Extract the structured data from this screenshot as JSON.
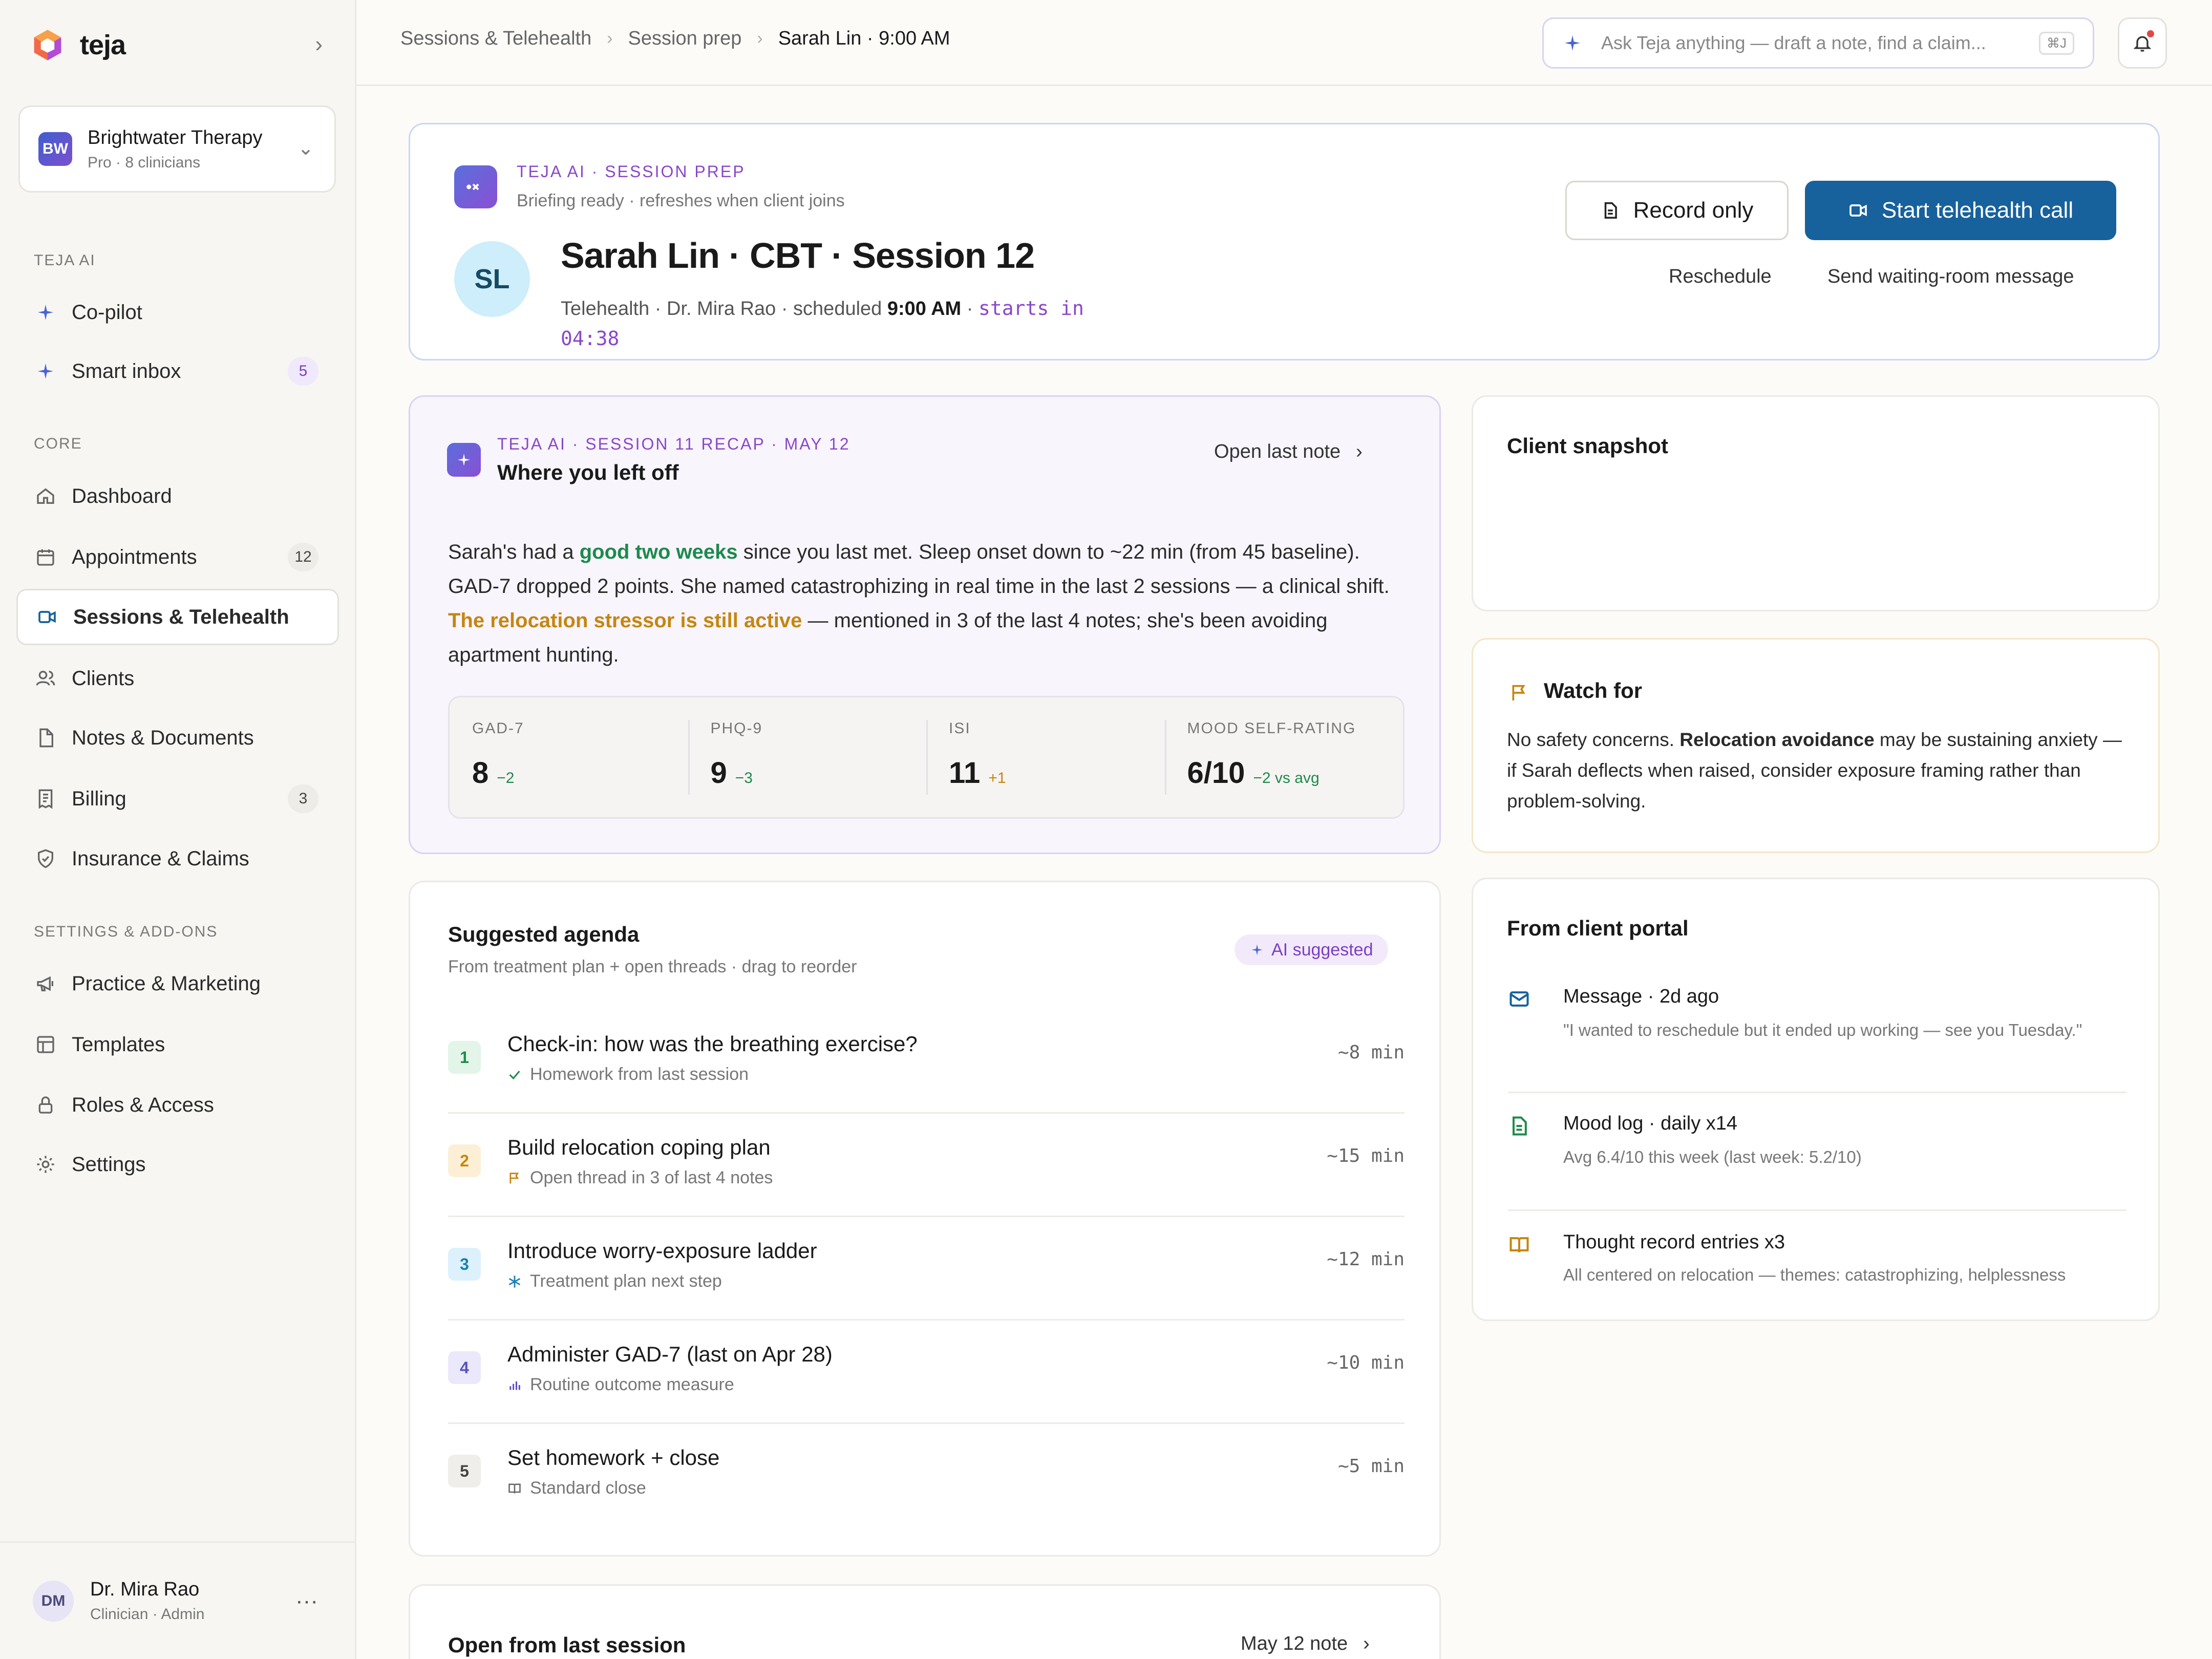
{
  "app": {
    "name": "teja"
  },
  "org": {
    "badge": "BW",
    "name": "Brightwater Therapy",
    "plan": "Pro · 8 clinicians"
  },
  "sidebar": {
    "sections": {
      "ai": "TEJA AI",
      "core": "CORE",
      "settings": "SETTINGS & ADD-ONS"
    },
    "ai_items": [
      {
        "label": "Co-pilot",
        "icon": "sparkle-icon"
      },
      {
        "label": "Smart inbox",
        "icon": "sparkle-icon",
        "count": "5"
      }
    ],
    "core_items": [
      {
        "label": "Dashboard",
        "icon": "home-icon"
      },
      {
        "label": "Appointments",
        "icon": "calendar-icon",
        "count": "12"
      },
      {
        "label": "Sessions & Telehealth",
        "icon": "video-icon",
        "active": true
      },
      {
        "label": "Clients",
        "icon": "users-icon"
      },
      {
        "label": "Notes & Documents",
        "icon": "document-icon"
      },
      {
        "label": "Billing",
        "icon": "receipt-icon",
        "count": "3"
      },
      {
        "label": "Insurance & Claims",
        "icon": "shield-icon"
      }
    ],
    "settings_items": [
      {
        "label": "Practice & Marketing",
        "icon": "megaphone-icon"
      },
      {
        "label": "Templates",
        "icon": "template-icon"
      },
      {
        "label": "Roles & Access",
        "icon": "lock-icon"
      },
      {
        "label": "Settings",
        "icon": "gear-icon"
      }
    ]
  },
  "user": {
    "initials": "DM",
    "name": "Dr. Mira Rao",
    "role": "Clinician · Admin"
  },
  "breadcrumbs": [
    "Sessions & Telehealth",
    "Session prep",
    "Sarah Lin · 9:00 AM"
  ],
  "search": {
    "placeholder": "Ask Teja anything — draft a note, find a claim...",
    "shortcut": "⌘J"
  },
  "prep": {
    "eyebrow": "TEJA AI · SESSION PREP",
    "status": "Briefing ready · refreshes when client joins",
    "initials": "SL",
    "title": "Sarah Lin · CBT · Session 12",
    "meta_prefix": "Telehealth · Dr. Mira Rao · scheduled",
    "time": "9:00 AM",
    "countdown_label": "starts in",
    "countdown": "04:38",
    "record_label": "Record only",
    "start_label": "Start telehealth call",
    "reschedule_label": "Reschedule",
    "waiting_label": "Send waiting-room message"
  },
  "recap": {
    "eyebrow": "TEJA AI · SESSION 11 RECAP · MAY 12",
    "title": "Where you left off",
    "open_label": "Open last note",
    "body": {
      "p1": "Sarah's had a ",
      "h1": "good two weeks",
      "p2": " since you last met. Sleep onset down to ~22 min (from 45 baseline). GAD-7 dropped 2 points. She named catastrophizing in real time in the last 2 sessions — a clinical shift. ",
      "h2": "The relocation stressor is still active",
      "p3": " — mentioned in 3 of the last 4 notes; she's been avoiding apartment hunting."
    },
    "scores": [
      {
        "label": "GAD-7",
        "value": "8",
        "delta": "−2",
        "tone": "green"
      },
      {
        "label": "PHQ-9",
        "value": "9",
        "delta": "−3",
        "tone": "green"
      },
      {
        "label": "ISI",
        "value": "11",
        "delta": "+1",
        "tone": "amber"
      },
      {
        "label": "MOOD SELF-RATING",
        "value": "6/10",
        "delta": "−2 vs avg",
        "tone": "green"
      }
    ]
  },
  "snapshot": {
    "title": "Client snapshot"
  },
  "watch": {
    "title": "Watch for",
    "p1": "No safety concerns. ",
    "bold": "Relocation avoidance",
    "p2": " may be sustaining anxiety — if Sarah deflects when raised, consider exposure framing rather than problem-solving."
  },
  "portal": {
    "title": "From client portal",
    "items": [
      {
        "icon": "mail-icon",
        "title": "Message · 2d ago",
        "sub": "\"I wanted to reschedule but it ended up working — see you Tuesday.\""
      },
      {
        "icon": "journal-icon",
        "title": "Mood log · daily x14",
        "sub": "Avg 6.4/10 this week (last week: 5.2/10)"
      },
      {
        "icon": "book-icon",
        "title": "Thought record entries x3",
        "sub": "All centered on relocation — themes: catastrophizing, helplessness"
      }
    ]
  },
  "agenda": {
    "title": "Suggested agenda",
    "subtitle": "From treatment plan + open threads · drag to reorder",
    "pill": "AI suggested",
    "items": [
      {
        "num": "1",
        "title": "Check-in: how was the breathing exercise?",
        "sub": "Homework from last session",
        "icon": "check-icon",
        "time": "~8 min",
        "bg": "#e2f5e8",
        "fg": "#1d8a4c"
      },
      {
        "num": "2",
        "title": "Build relocation coping plan",
        "sub": "Open thread in 3 of last 4 notes",
        "icon": "flag-icon",
        "time": "~15 min",
        "bg": "#fcefd6",
        "fg": "#c58610"
      },
      {
        "num": "3",
        "title": "Introduce worry-exposure ladder",
        "sub": "Treatment plan next step",
        "icon": "snowflake-icon",
        "time": "~12 min",
        "bg": "#dcf1fb",
        "fg": "#1a7fb0"
      },
      {
        "num": "4",
        "title": "Administer GAD-7 (last on Apr 28)",
        "sub": "Routine outcome measure",
        "icon": "bar-chart-icon",
        "time": "~10 min",
        "bg": "#ebe8fb",
        "fg": "#5a4fc4"
      },
      {
        "num": "5",
        "title": "Set homework + close",
        "sub": "Standard close",
        "icon": "book-icon",
        "time": "~5 min",
        "bg": "#efeeea",
        "fg": "#444"
      }
    ]
  },
  "open_last": {
    "title": "Open from last session",
    "link": "May 12 note"
  },
  "colors": {
    "accent": "#17619d",
    "ai_purple": "#8a47c8",
    "positive": "#1d8a4c",
    "warning": "#c58610"
  }
}
